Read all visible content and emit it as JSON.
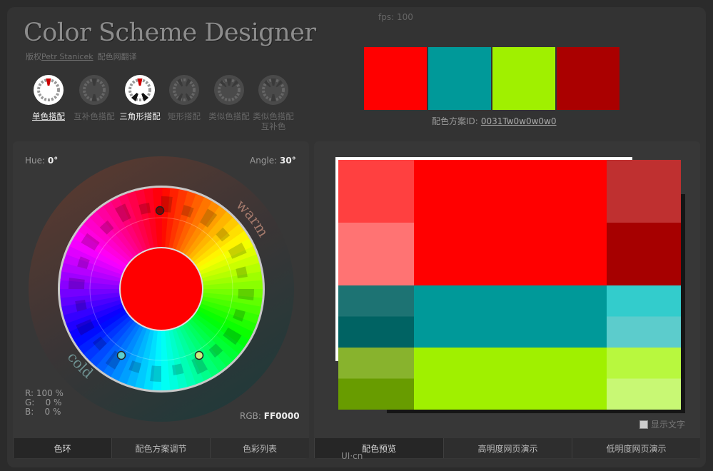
{
  "app": {
    "title": "Color Scheme Designer",
    "fps": "fps: 100",
    "credit_prefix": "版权",
    "credit_author": "Petr Stanicek",
    "credit_translate": "配色网翻译"
  },
  "modes": [
    {
      "label": "单色搭配",
      "active": true
    },
    {
      "label": "互补色搭配",
      "active": false
    },
    {
      "label": "三角形搭配",
      "active": true
    },
    {
      "label": "矩形搭配",
      "active": false
    },
    {
      "label": "类似色搭配",
      "active": false
    },
    {
      "label": "类似色搭配互补色",
      "active": false
    }
  ],
  "scheme": {
    "swatches": [
      "#FF0000",
      "#009999",
      "#A0F000",
      "#AA0000"
    ],
    "id_label": "配色方案ID:",
    "id_value": "0031Tw0w0w0w0"
  },
  "wheel": {
    "hue_label": "Hue:",
    "hue_value": "0°",
    "angle_label": "Angle:",
    "angle_value": "30°",
    "warm": "warm",
    "cold": "cold",
    "r": "R: 100 %",
    "g": "G:    0 %",
    "b": "B:    0 %",
    "rgb_label": "RGB:",
    "rgb_value": "FF0000",
    "center_color": "#FF0000"
  },
  "tabs_left": [
    "色环",
    "配色方案调节",
    "色彩列表"
  ],
  "tabs_right": [
    "配色预览",
    "高明度网页演示",
    "低明度网页演示"
  ],
  "preview": {
    "rows": [
      {
        "left": [
          "#FF4040",
          "#FF7373"
        ],
        "main": "#FF0000",
        "right": [
          "#BF3030",
          "#A60000"
        ]
      },
      {
        "left": [
          "#1D7373",
          "#006363"
        ],
        "main": "#009999",
        "right": [
          "#33CCCC",
          "#5CCCCC"
        ]
      },
      {
        "left": [
          "#88B32D",
          "#689C00"
        ],
        "main": "#A0F000",
        "right": [
          "#B8F83E",
          "#C8F874"
        ]
      }
    ],
    "show_text": "显示文字"
  },
  "watermark": "UI·cn"
}
